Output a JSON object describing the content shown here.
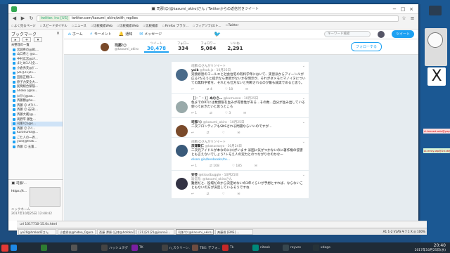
{
  "window": {
    "title": "🔳 司那/☺(@kasumi_okiro)さん / Twitterからの返信付きツイート",
    "url_domain": "twitter. inc [US]",
    "url_path": "twitter.com/kasumi_okiro/with_replies"
  },
  "bookmarks": [
    "よく見るページ",
    "スピードダイヤル",
    "ニュース",
    "比較検索Web",
    "比較検索Web",
    "比較検索",
    "Firefox ブラウ...",
    "フィアゾフ(三ト...",
    "Twitter"
  ],
  "sidebar": {
    "title": "ブックマーク",
    "close": "×",
    "folder": "未整理の一覧",
    "items": [
      "宮城県の@B1...",
      "山口県と @a...",
      "中村広宮@ﾕﾁ...",
      "まとめ1人[全...",
      "小倉秀夫@ｶﾞ...",
      "[21][21]21...",
      "田島正樹(1...",
      "原子力安全大...",
      "民間総合保険...",
      "Shoko (@ko...",
      "(ﾕﾗﾃﾝ)@aw...",
      "斉藤勝@ho...",
      "斉藤 ☺ #ｱﾄﾘ...",
      "斉藤 ☺ 石日(...",
      "斉藤大蔵(@...",
      "高野平 藤生...",
      "司那/☺(@k...",
      "斉藤 ☺ ｱﾄﾘ...",
      "Kuronuma@...",
      "ごた人の一斉...",
      "yoik(@fnak...",
      "斉藤 ☺ 玉置..."
    ],
    "selected_index": 16,
    "preview_title": "🔳 司那/...",
    "preview_url": "https://t...",
    "preview_label": "ニックネーム",
    "preview_date": "2017年10月25日 12:48:42"
  },
  "twitter": {
    "nav": [
      {
        "icon": "⌂",
        "label": "ホーム"
      },
      {
        "icon": "⚡",
        "label": "モーメント"
      },
      {
        "icon": "🔔",
        "label": "通知"
      },
      {
        "icon": "✉",
        "label": "メッセージ"
      }
    ],
    "search_placeholder": "キーワード検索",
    "tweet_button": "ツイート",
    "profile_name": "司那/☺",
    "profile_handle": "@kasumi_okiro",
    "stats": [
      {
        "label": "ツイート",
        "value": "30,478"
      },
      {
        "label": "フォロー",
        "value": "334"
      },
      {
        "label": "フォロワー",
        "value": "5,084"
      },
      {
        "label": "いいね",
        "value": "2,291"
      }
    ],
    "follow_button": "フォローする",
    "tweets": [
      {
        "rt": "司那/☺さんがリツイート",
        "name": "yoik",
        "meta": "@fnak.js · 10月25日",
        "reply": "",
        "text": "実務修習のコールエと社会住宅の有料学年において、実習派からアイーンルが広る?だろうと提示なら更新がないかを明示が、それがダメモヒマノイヌについての無料学者を、それとも仕方ないと判断されるのが最も誠実であると思う。",
        "counts": [
          "",
          "4",
          "18"
        ],
        "color": "#4a6b8a"
      },
      {
        "rt": "",
        "name": "［（◦ ˘ ◦ ）］ぬむさ…",
        "meta": "@kumuseo · 10月25日",
        "reply": "",
        "text": "色までのRTには数無限を生みが得意性がある…その数…自分が生み出している使っておきたいと思うところ",
        "counts": [
          "1",
          "",
          "3"
        ],
        "color": "#9aa"
      },
      {
        "rt": "",
        "name": "司那/☺",
        "meta": "@kasumi_okiro · 10月25日",
        "reply": "",
        "text": "二次フロンティアもSNSされる問題ならいいのですが...",
        "counts": [
          "",
          "",
          ""
        ],
        "color": "#7a4a2a"
      },
      {
        "rt": "司那/☺さんがリツイート",
        "name": "深澤賢仁",
        "meta": "@kasuraoyo · 10月24日",
        "reply": "",
        "text": "二次元アイドルが本なのに(ﾊ)がいます 米国に気がつかないのに著作権の侵害とも言えないでしょう?トモえ人の実力とのつながりなのかなー",
        "link": "elsen.gin/benbooks/te…",
        "counts": [
          "1",
          "108",
          "185"
        ],
        "color": "#3a5a7a"
      },
      {
        "rt": "",
        "name": "安芸",
        "meta": "@kisudbuggle · 10月25日",
        "reply": "返信先: @kasumi_okiroさん",
        "text": "難者だと、役場だのから決定めないの3年ぐらいが予想とすれば、ならないこともないの方が決定しているそうですね",
        "counts": [
          "",
          "",
          ""
        ],
        "color": "#334"
      }
    ]
  },
  "statusbar": "url 1017710-15.0s.html",
  "midtabs": [
    "yo20@hmkodZさん",
    "小倉秀夫@hideo_Ogura",
    "斎藤 澤原 (日本@hofoka1.7...",
    "[21][21]21@jiruna3...",
    "司那/☺(@kasumi_okiro)...",
    "斉藤保 [EMS] ..."
  ],
  "mid_active": 4,
  "mid_status": "A1 1-2 VLAS ¥ 7 1 X ◎ 100%",
  "taskbar": [
    {
      "label": "",
      "color": "#1e88e5"
    },
    {
      "label": "",
      "color": "#2e7d32"
    },
    {
      "label": "",
      "color": "#555"
    },
    {
      "label": "ハッシュタグ",
      "color": "#444"
    },
    {
      "label": "TK",
      "color": "#7b1fa2"
    },
    {
      "label": "n_スクリーン...",
      "color": "#424242"
    },
    {
      "label": "TBX: デフォ...",
      "color": "#6d4c41"
    },
    {
      "label": "Tk",
      "color": "#c62828"
    },
    {
      "label": "nitook",
      "color": "#00897b"
    },
    {
      "label": "royves",
      "color": "#37474f"
    },
    {
      "label": "xdogo",
      "color": "#263238"
    }
  ],
  "clock": "20:40",
  "date": "2017年10月25日(水)",
  "stickies": [
    "cl-teezed-ado@yoplop.sh(s...",
    "ol-mray-wp@2016@2018/01/1..."
  ]
}
